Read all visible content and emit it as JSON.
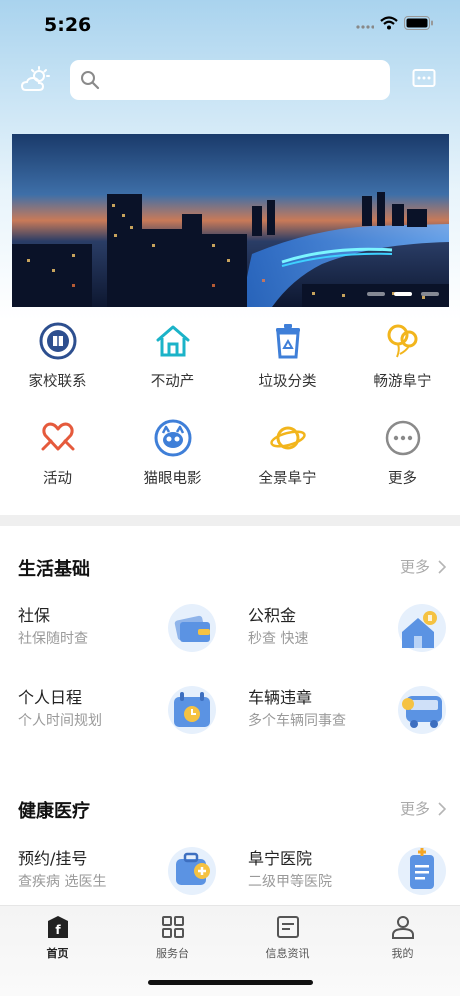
{
  "status_bar": {
    "time": "5:26"
  },
  "header": {
    "search": {
      "value": "",
      "placeholder": ""
    }
  },
  "banner": {
    "slide_count": 3,
    "active_slide": 2
  },
  "quick_grid": [
    {
      "label": "家校联系",
      "icon": "school-seal-icon"
    },
    {
      "label": "不动产",
      "icon": "house-icon"
    },
    {
      "label": "垃圾分类",
      "icon": "recycle-bin-icon"
    },
    {
      "label": "畅游阜宁",
      "icon": "balloon-icon"
    },
    {
      "label": "活动",
      "icon": "heart-hands-icon"
    },
    {
      "label": "猫眼电影",
      "icon": "cat-eye-icon"
    },
    {
      "label": "全景阜宁",
      "icon": "planet-icon"
    },
    {
      "label": "更多",
      "icon": "more-dots-icon"
    }
  ],
  "sections": [
    {
      "title": "生活基础",
      "more": "更多",
      "items": [
        {
          "title": "社保",
          "subtitle": "社保随时查",
          "icon": "card-wallet-icon"
        },
        {
          "title": "公积金",
          "subtitle": "秒查 快速",
          "icon": "house-coin-icon"
        },
        {
          "title": "个人日程",
          "subtitle": "个人时间规划",
          "icon": "calendar-clock-icon"
        },
        {
          "title": "车辆违章",
          "subtitle": "多个车辆同事查",
          "icon": "bus-icon"
        }
      ]
    },
    {
      "title": "健康医疗",
      "more": "更多",
      "items": [
        {
          "title": "预约/挂号",
          "subtitle": "查疾病 选医生",
          "icon": "medical-kit-icon"
        },
        {
          "title": "阜宁医院",
          "subtitle": "二级甲等医院",
          "icon": "hospital-clipboard-icon"
        }
      ]
    }
  ],
  "tabbar": [
    {
      "label": "首页",
      "icon": "home-f-icon",
      "active": true
    },
    {
      "label": "服务台",
      "icon": "grid-four-icon",
      "active": false
    },
    {
      "label": "信息资讯",
      "icon": "news-icon",
      "active": false
    },
    {
      "label": "我的",
      "icon": "user-icon",
      "active": false
    }
  ],
  "colors": {
    "accent": "#1e88e5",
    "icon_blue": "#3f7fd8",
    "icon_red": "#e55a3c",
    "icon_yellow": "#f2b51c",
    "icon_teal": "#1bb3c8"
  }
}
